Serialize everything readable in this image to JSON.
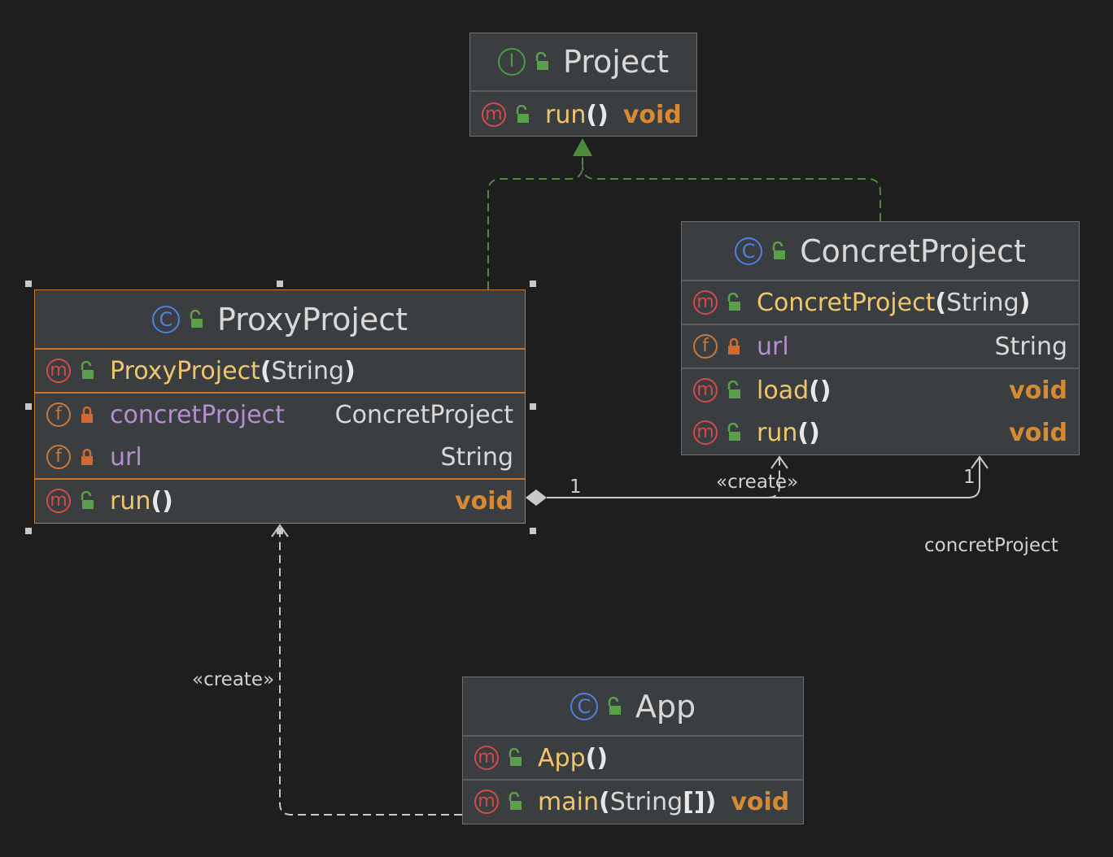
{
  "classes": {
    "project": {
      "kind": "I",
      "name": "Project",
      "methods": [
        {
          "name": "run",
          "params": "",
          "return": "void"
        }
      ]
    },
    "concret_project": {
      "kind": "C",
      "name": "ConcretProject",
      "constructor": {
        "name": "ConcretProject",
        "params": "String"
      },
      "fields": [
        {
          "name": "url",
          "type": "String",
          "visibility": "private"
        }
      ],
      "methods": [
        {
          "name": "load",
          "params": "",
          "return": "void"
        },
        {
          "name": "run",
          "params": "",
          "return": "void"
        }
      ]
    },
    "proxy_project": {
      "kind": "C",
      "name": "ProxyProject",
      "constructor": {
        "name": "ProxyProject",
        "params": "String"
      },
      "fields": [
        {
          "name": "concretProject",
          "type": "ConcretProject",
          "visibility": "private"
        },
        {
          "name": "url",
          "type": "String",
          "visibility": "private"
        }
      ],
      "methods": [
        {
          "name": "run",
          "params": "",
          "return": "void"
        }
      ]
    },
    "app": {
      "kind": "C",
      "name": "App",
      "constructor": {
        "name": "App",
        "params": ""
      },
      "methods": [
        {
          "name": "main",
          "params": "String",
          "params_suffix": "[]",
          "return": "void"
        }
      ]
    }
  },
  "icons": {
    "method": "m",
    "field": "f",
    "class": "C",
    "interface": "I",
    "public": "unlock-icon",
    "private": "lock-icon"
  },
  "edges": {
    "create_label": "«create»",
    "multiplicity_source": "1",
    "multiplicity_target": "1",
    "association_role": "concretProject"
  },
  "colors": {
    "background": "#1e1e1e",
    "box": "#3b3e40",
    "selected_border": "#c4782d",
    "method_name": "#f0c66c",
    "field_name": "#b48ece",
    "return_type": "#d78a34",
    "realization_edge": "#4e8a3e",
    "dependency_edge": "#c8c8c8"
  }
}
